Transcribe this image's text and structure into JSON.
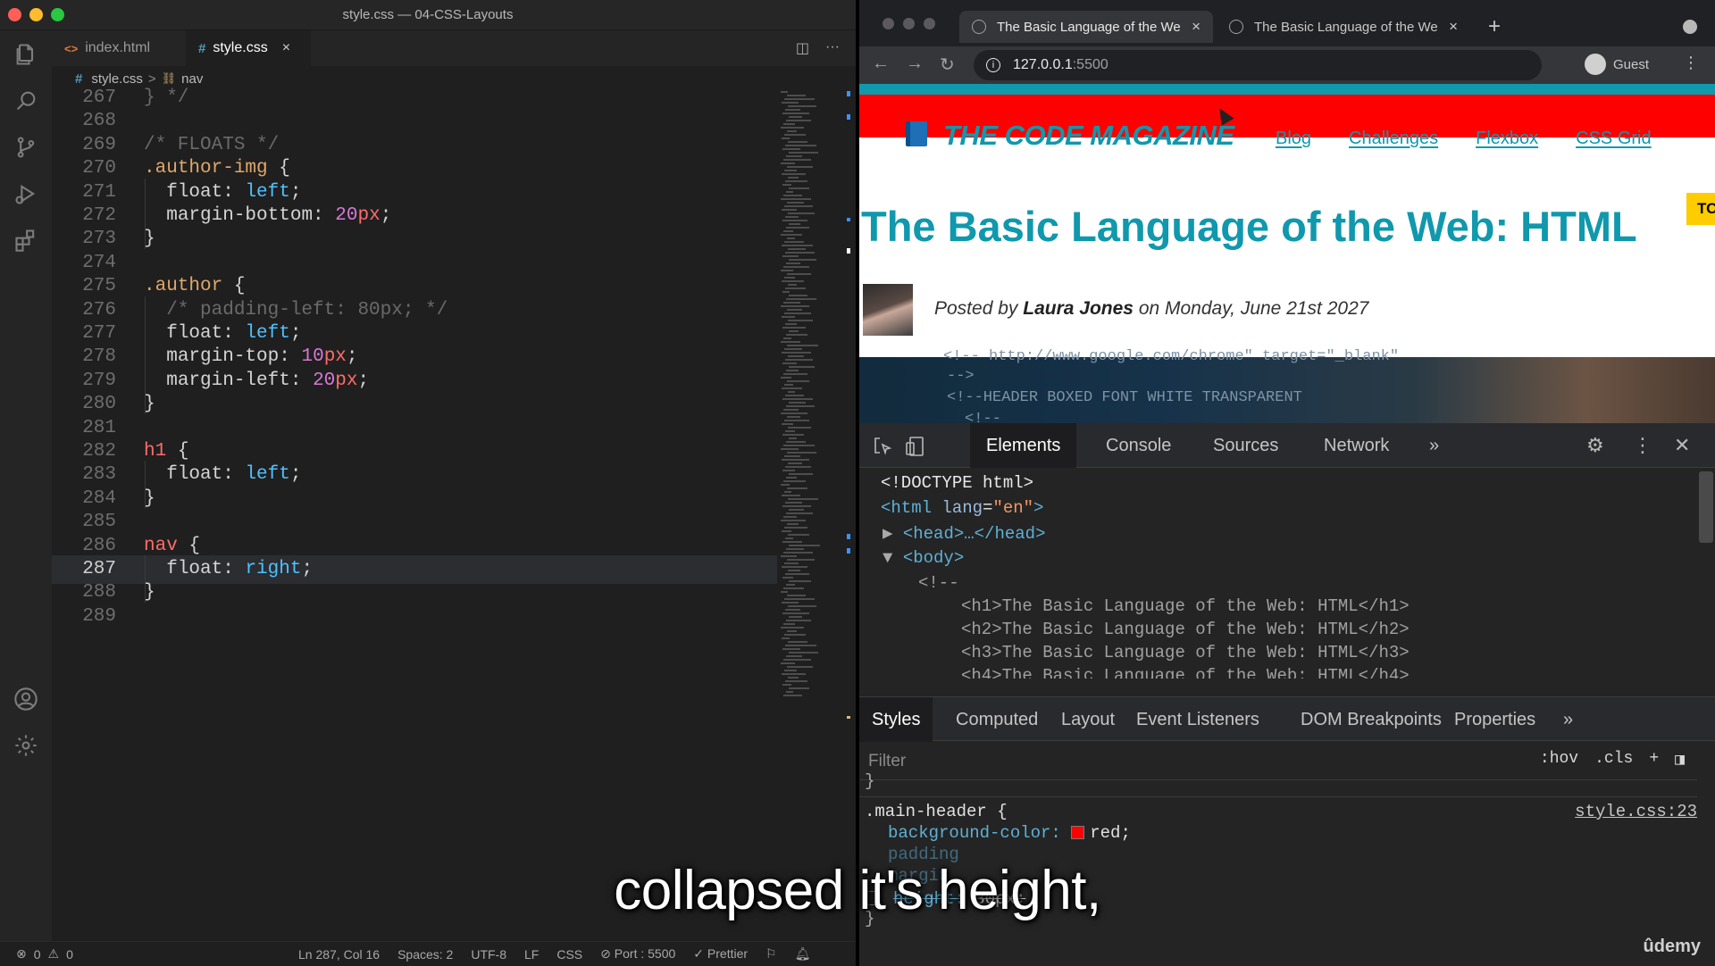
{
  "vscode": {
    "window_title": "style.css — 04-CSS-Layouts",
    "tabs": [
      {
        "label": "index.html",
        "icon": "html-file-icon"
      },
      {
        "label": "style.css",
        "icon": "css-file-icon",
        "close": "×"
      }
    ],
    "breadcrumb": {
      "file": "style.css",
      "sep": ">",
      "symbol": "nav"
    },
    "status": {
      "errors": "0",
      "warnings": "0",
      "position": "Ln 287, Col 16",
      "spaces": "Spaces: 2",
      "encoding": "UTF-8",
      "eol": "LF",
      "language": "CSS",
      "port": "Port : 5500",
      "prettier": "Prettier"
    }
  },
  "editor_lines": [
    {
      "n": "267",
      "text": "} */"
    },
    {
      "n": "268",
      "text": ""
    },
    {
      "n": "269",
      "text": "/* FLOATS */"
    },
    {
      "n": "270",
      "text": ".author-img {"
    },
    {
      "n": "271",
      "text": "  float: left;"
    },
    {
      "n": "272",
      "text": "  margin-bottom: 20px;"
    },
    {
      "n": "273",
      "text": "}"
    },
    {
      "n": "274",
      "text": ""
    },
    {
      "n": "275",
      "text": ".author {"
    },
    {
      "n": "276",
      "text": "  /* padding-left: 80px; */"
    },
    {
      "n": "277",
      "text": "  float: left;"
    },
    {
      "n": "278",
      "text": "  margin-top: 10px;"
    },
    {
      "n": "279",
      "text": "  margin-left: 20px;"
    },
    {
      "n": "280",
      "text": "}"
    },
    {
      "n": "281",
      "text": ""
    },
    {
      "n": "282",
      "text": "h1 {"
    },
    {
      "n": "283",
      "text": "  float: left;"
    },
    {
      "n": "284",
      "text": "}"
    },
    {
      "n": "285",
      "text": ""
    },
    {
      "n": "286",
      "text": "nav {"
    },
    {
      "n": "287",
      "text": "  float: right;"
    },
    {
      "n": "288",
      "text": "}"
    },
    {
      "n": "289",
      "text": ""
    }
  ],
  "chrome": {
    "tabs": [
      {
        "title": "The Basic Language of the We",
        "close": "×"
      },
      {
        "title": "The Basic Language of the We",
        "close": "×"
      }
    ],
    "new_tab": "+",
    "url_host": "127.0.0.1",
    "url_port": ":5500",
    "profile": "Guest"
  },
  "page": {
    "logo": "THE CODE MAGAZINE",
    "nav": [
      "Blog",
      "Challenges",
      "Flexbox",
      "CSS Grid"
    ],
    "badge": "TO",
    "h1": "The Basic Language of the Web: HTML",
    "posted_by": "Posted by",
    "author": "Laura Jones",
    "date": "on Monday, June 21st 2027",
    "code_bg_lines": [
      "<!-- http://www.google.com/chrome\" target=\"_blank\"",
      "-->",
      "<!--HEADER BOXED FONT WHITE TRANSPARENT",
      "<!--"
    ]
  },
  "devtools": {
    "tabs": [
      "Elements",
      "Console",
      "Sources",
      "Network",
      "»"
    ],
    "dom": {
      "doctype": "<!DOCTYPE html>",
      "html_open": "<html",
      "html_attr": "lang",
      "html_val": "\"en\"",
      "html_close": ">",
      "head": "<head>…</head>",
      "body": "<body>",
      "comment": "<!--",
      "h1": "<h1>The Basic Language of the Web: HTML</h1>",
      "h2": "<h2>The Basic Language of the Web: HTML</h2>",
      "h3": "<h3>The Basic Language of the Web: HTML</h3>",
      "h4": "<h4>The Basic Language of the Web: HTML</h4>"
    },
    "styles_tabs": [
      "Styles",
      "Computed",
      "Layout",
      "Event Listeners",
      "DOM Breakpoints",
      "Properties",
      "»"
    ],
    "filter_placeholder": "Filter",
    "hov": ":hov",
    "cls": ".cls",
    "plus": "+",
    "rule_close": "}",
    "rule": {
      "selector": ".main-header",
      "open": "{",
      "source": "style.css:23",
      "bg_prop": "background-color:",
      "bg_val": "red;",
      "partial1": "padding",
      "partial2": "margin",
      "height_prop": "height:",
      "height_val": "80px;",
      "close": "}"
    }
  },
  "watermark": "ûdemy",
  "subtitle": "collapsed it's height,"
}
